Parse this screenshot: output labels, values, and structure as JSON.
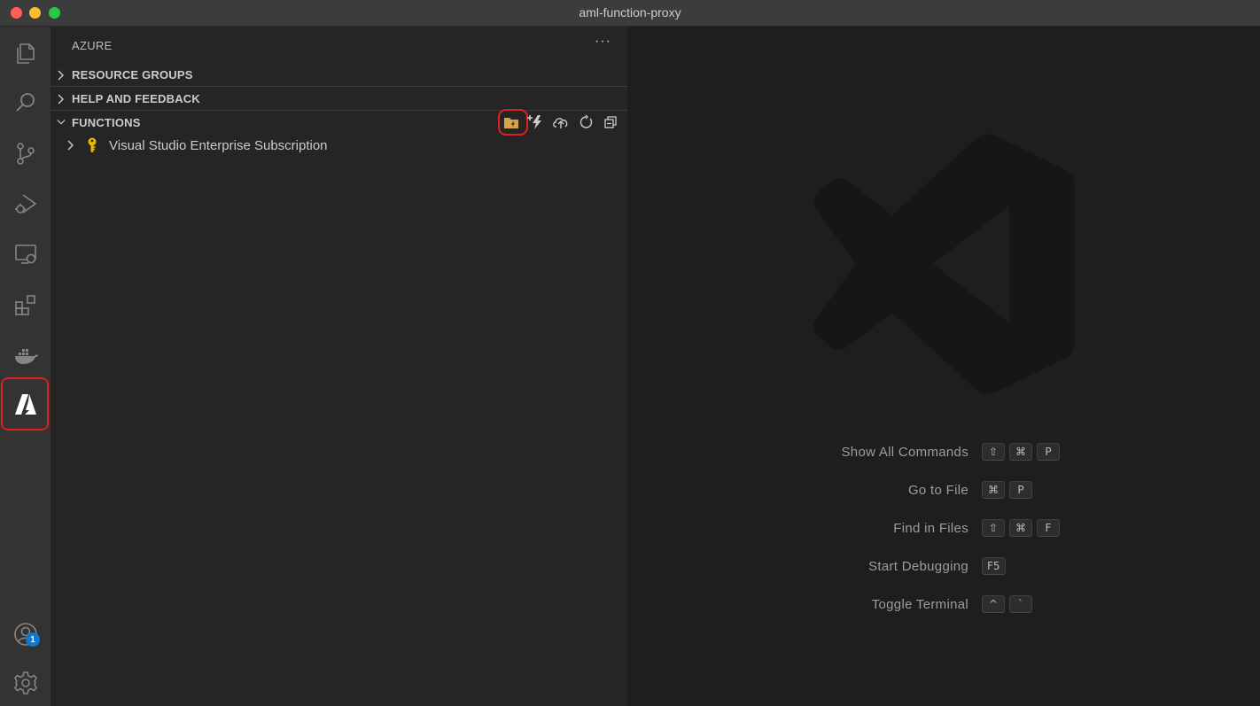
{
  "window": {
    "title": "aml-function-proxy"
  },
  "activity_bar": {
    "items": [
      {
        "name": "explorer-icon"
      },
      {
        "name": "search-icon"
      },
      {
        "name": "source-control-icon"
      },
      {
        "name": "run-debug-icon"
      },
      {
        "name": "remote-explorer-icon"
      },
      {
        "name": "extensions-icon"
      },
      {
        "name": "docker-icon"
      },
      {
        "name": "azure-icon",
        "active": true
      }
    ],
    "accounts_badge": "1"
  },
  "sidebar": {
    "title": "AZURE",
    "more_label": "···",
    "sections": {
      "resource_groups": "RESOURCE GROUPS",
      "help_feedback": "HELP AND FEEDBACK",
      "functions": "FUNCTIONS"
    },
    "functions_tools": [
      "create-new-project-icon",
      "create-function-icon",
      "deploy-icon",
      "refresh-icon",
      "collapse-all-icon"
    ],
    "tree": {
      "subscription": "Visual Studio Enterprise Subscription"
    }
  },
  "editor": {
    "shortcuts": [
      {
        "label": "Show All Commands",
        "keys": [
          "⇧",
          "⌘",
          "P"
        ]
      },
      {
        "label": "Go to File",
        "keys": [
          "⌘",
          "P"
        ]
      },
      {
        "label": "Find in Files",
        "keys": [
          "⇧",
          "⌘",
          "F"
        ]
      },
      {
        "label": "Start Debugging",
        "keys": [
          "F5"
        ]
      },
      {
        "label": "Toggle Terminal",
        "keys": [
          "^",
          "`"
        ]
      }
    ]
  },
  "colors": {
    "highlight": "#e02020",
    "badge": "#0e78d5",
    "key_icon": "#e8b800"
  }
}
